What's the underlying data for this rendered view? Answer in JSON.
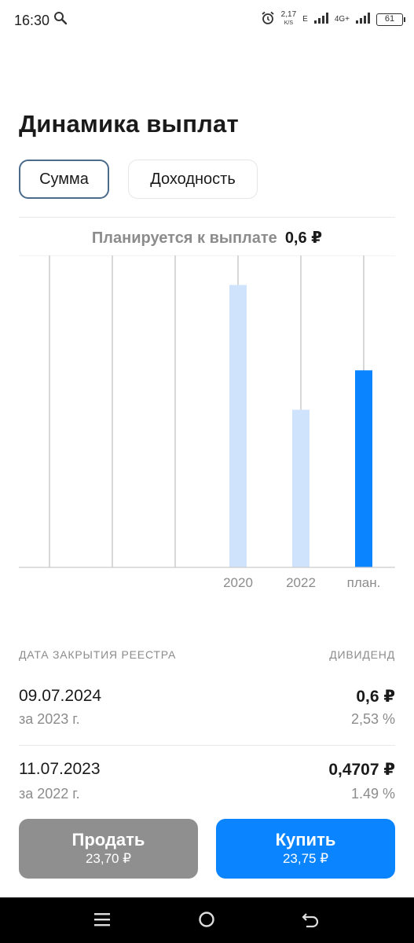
{
  "status_bar": {
    "time": "16:30",
    "net_speed_value": "2,17",
    "net_speed_unit": "K/S",
    "network_type": "E",
    "network_lte": "4G+",
    "battery": "61",
    "icons": [
      "search-icon",
      "alarm-icon",
      "signal-icon",
      "battery-icon"
    ]
  },
  "page": {
    "title": "Динамика выплат",
    "segments": [
      {
        "label": "Сумма",
        "selected": true
      },
      {
        "label": "Доходность",
        "selected": false
      }
    ],
    "planned_label": "Планируется к выплате",
    "planned_value": "0,6 ₽"
  },
  "chart_data": {
    "type": "bar",
    "categories": [
      "",
      "",
      "",
      "2020",
      "2022",
      "план."
    ],
    "values": [
      0,
      0,
      0,
      0.86,
      0.48,
      0.6
    ],
    "highlight_index": 5,
    "colors": {
      "past": "#cfe3fc",
      "planned": "#0a84ff",
      "grid": "#cccccc"
    },
    "ylim": [
      0,
      0.95
    ]
  },
  "table": {
    "header_left": "ДАТА ЗАКРЫТИЯ РЕЕСТРА",
    "header_right": "ДИВИДЕНД",
    "rows": [
      {
        "date": "09.07.2024",
        "period": "за 2023 г.",
        "amount": "0,6 ₽",
        "yield": "2,53 %"
      },
      {
        "date": "11.07.2023",
        "period": "за 2022 г.",
        "amount": "0,4707 ₽",
        "yield": "1.49 %"
      }
    ]
  },
  "actions": {
    "sell_label": "Продать",
    "sell_price": "23,70 ₽",
    "buy_label": "Купить",
    "buy_price": "23,75 ₽",
    "sell_color": "#8f8f8f",
    "buy_color": "#0a84ff"
  },
  "navbar": {
    "icons": [
      "menu-icon",
      "home-icon",
      "back-icon"
    ]
  }
}
